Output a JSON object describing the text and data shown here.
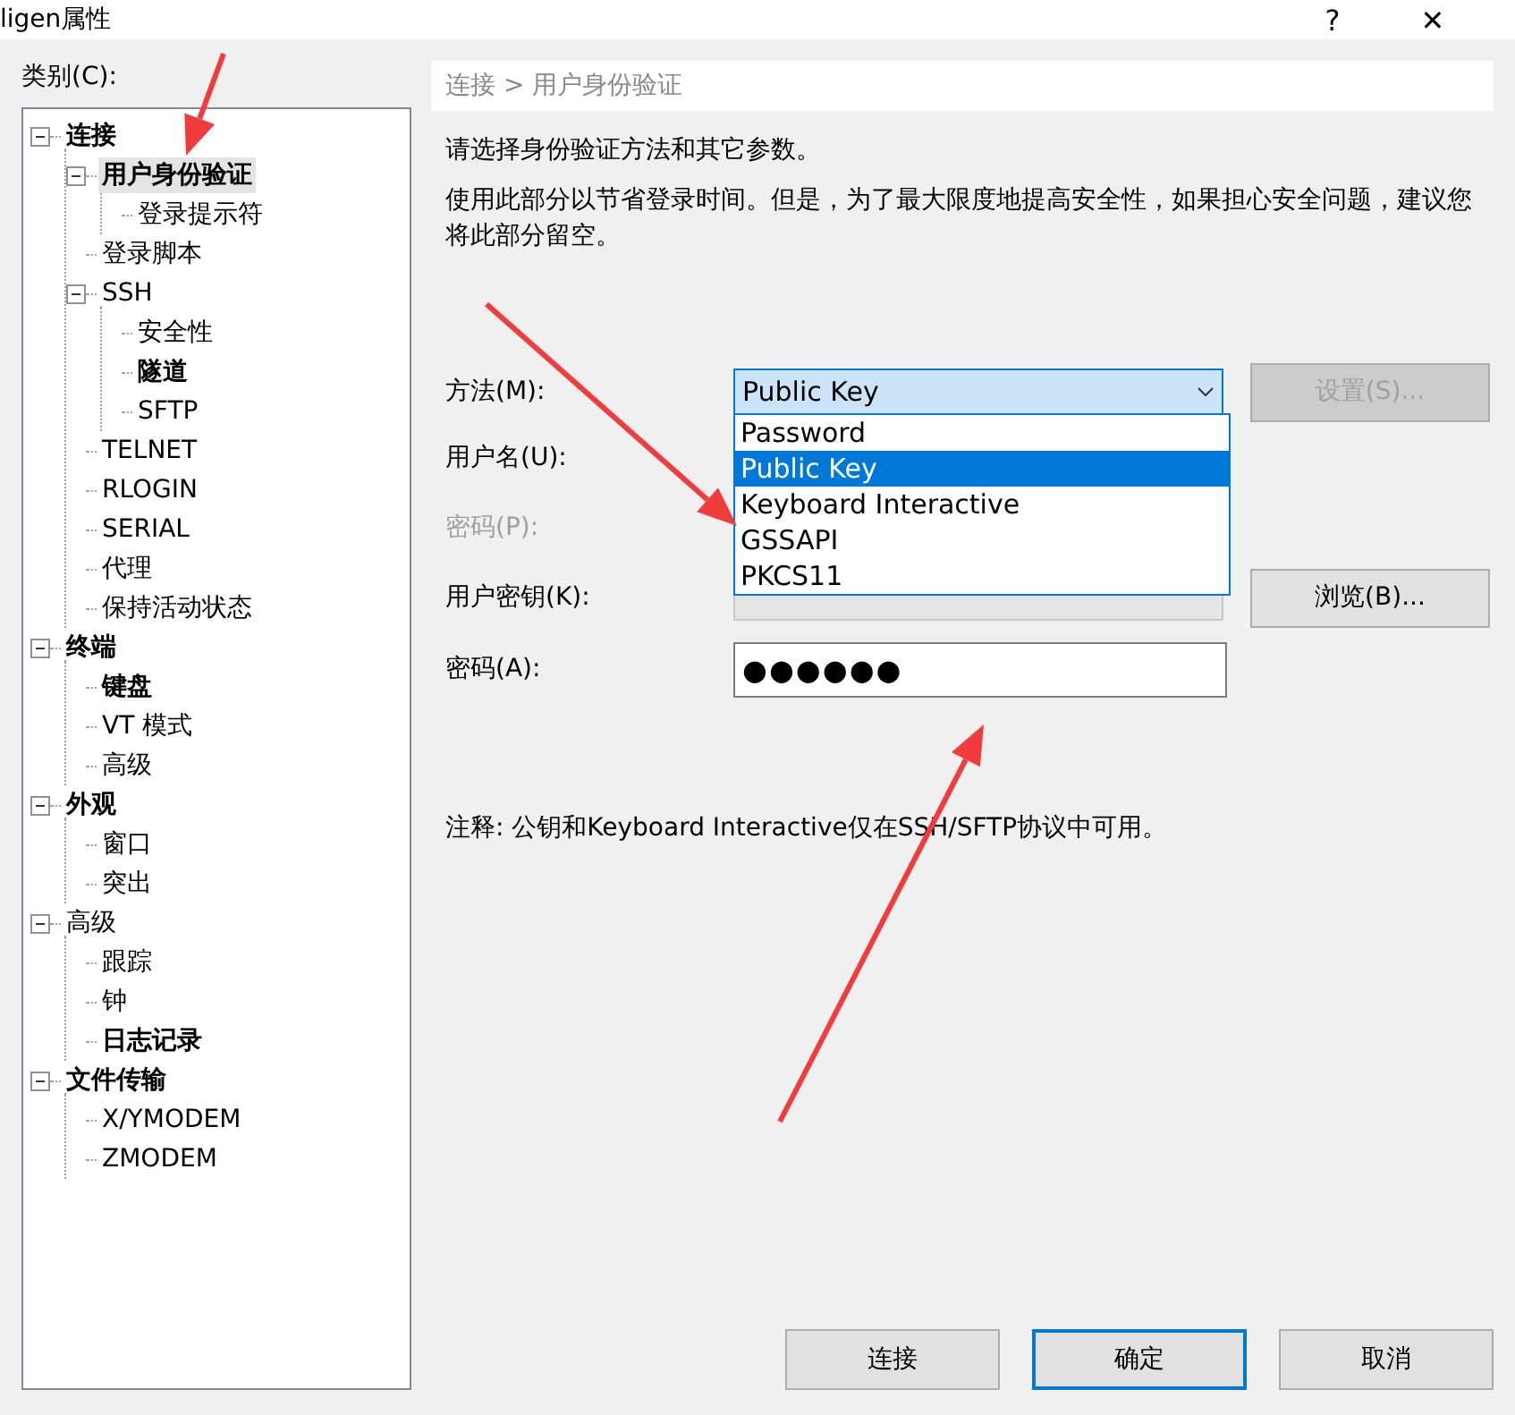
{
  "window": {
    "title": "ligen属性",
    "help": "?",
    "close": "✕"
  },
  "category_label": "类别(C):",
  "tree": [
    {
      "label": "连接",
      "bold": true,
      "selected": false,
      "expanded": true,
      "children": [
        {
          "label": "用户身份验证",
          "bold": true,
          "selected": true,
          "expanded": true,
          "children": [
            {
              "label": "登录提示符",
              "bold": false,
              "selected": false
            }
          ]
        },
        {
          "label": "登录脚本",
          "bold": false,
          "selected": false
        },
        {
          "label": "SSH",
          "bold": false,
          "selected": false,
          "expanded": true,
          "children": [
            {
              "label": "安全性",
              "bold": false,
              "selected": false
            },
            {
              "label": "隧道",
              "bold": true,
              "selected": false
            },
            {
              "label": "SFTP",
              "bold": false,
              "selected": false
            }
          ]
        },
        {
          "label": "TELNET",
          "bold": false,
          "selected": false
        },
        {
          "label": "RLOGIN",
          "bold": false,
          "selected": false
        },
        {
          "label": "SERIAL",
          "bold": false,
          "selected": false
        },
        {
          "label": "代理",
          "bold": false,
          "selected": false
        },
        {
          "label": "保持活动状态",
          "bold": false,
          "selected": false
        }
      ]
    },
    {
      "label": "终端",
      "bold": true,
      "selected": false,
      "expanded": true,
      "children": [
        {
          "label": "键盘",
          "bold": true,
          "selected": false
        },
        {
          "label": "VT 模式",
          "bold": false,
          "selected": false
        },
        {
          "label": "高级",
          "bold": false,
          "selected": false
        }
      ]
    },
    {
      "label": "外观",
      "bold": true,
      "selected": false,
      "expanded": true,
      "children": [
        {
          "label": "窗口",
          "bold": false,
          "selected": false
        },
        {
          "label": "突出",
          "bold": false,
          "selected": false
        }
      ]
    },
    {
      "label": "高级",
      "bold": false,
      "selected": false,
      "expanded": true,
      "children": [
        {
          "label": "跟踪",
          "bold": false,
          "selected": false
        },
        {
          "label": "钟",
          "bold": false,
          "selected": false
        },
        {
          "label": "日志记录",
          "bold": true,
          "selected": false
        }
      ]
    },
    {
      "label": "文件传输",
      "bold": true,
      "selected": false,
      "expanded": true,
      "children": [
        {
          "label": "X/YMODEM",
          "bold": false,
          "selected": false
        },
        {
          "label": "ZMODEM",
          "bold": false,
          "selected": false
        }
      ]
    }
  ],
  "breadcrumb": "连接 > 用户身份验证",
  "intro": "请选择身份验证方法和其它参数。",
  "description": "使用此部分以节省登录时间。但是，为了最大限度地提高安全性，如果担心安全问题，建议您将此部分留空。",
  "method": {
    "label": "方法(M):",
    "value": "Public Key",
    "options": [
      {
        "label": "Password",
        "selected": false
      },
      {
        "label": "Public Key",
        "selected": true
      },
      {
        "label": "Keyboard Interactive",
        "selected": false
      },
      {
        "label": "GSSAPI",
        "selected": false
      },
      {
        "label": "PKCS11",
        "selected": false
      }
    ],
    "button": {
      "label": "设置(S)...",
      "disabled": true
    }
  },
  "username": {
    "label": "用户名(U):"
  },
  "password_p": {
    "label": "密码(P):",
    "disabled": true
  },
  "user_key": {
    "label": "用户密钥(K):",
    "disabled": true,
    "button": {
      "label": "浏览(B)...",
      "disabled": false
    }
  },
  "passphrase": {
    "label": "密码(A):",
    "value": "●●●●●●"
  },
  "note": "注释: 公钥和Keyboard Interactive仅在SSH/SFTP协议中可用。",
  "buttons": [
    {
      "label": "连接",
      "default": false
    },
    {
      "label": "确定",
      "default": true
    },
    {
      "label": "取消",
      "default": false
    }
  ]
}
